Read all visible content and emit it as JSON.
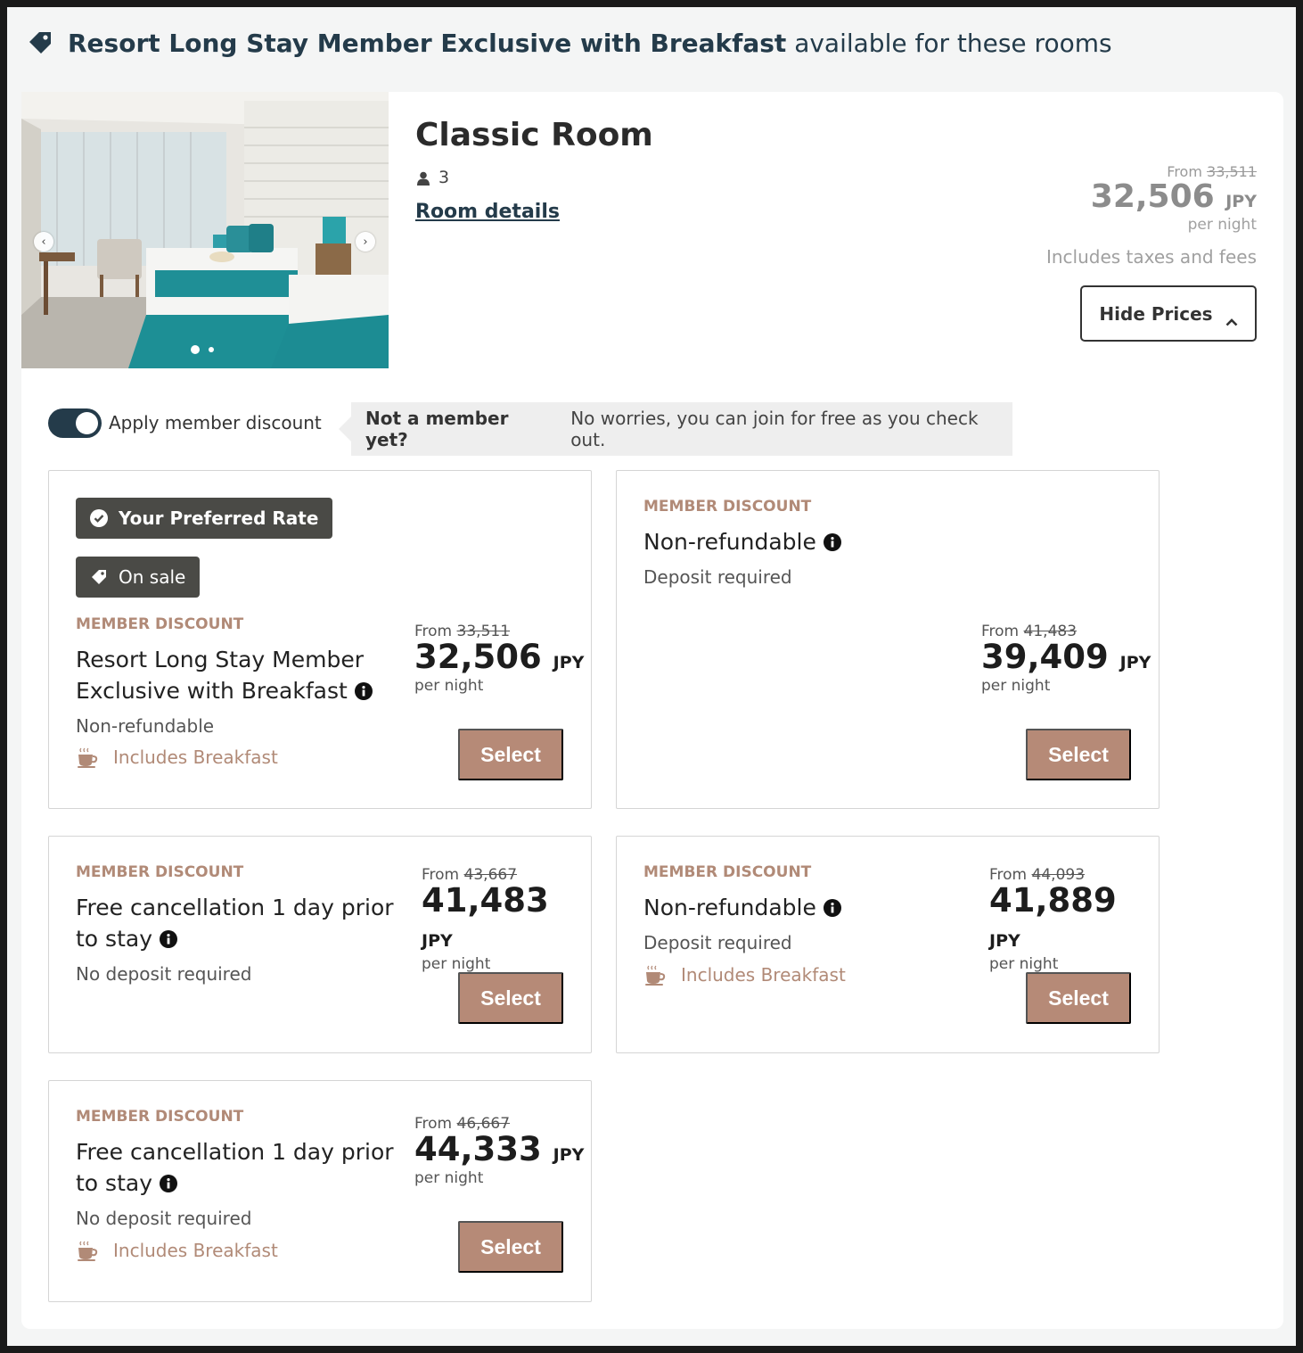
{
  "banner": {
    "icon": "tag-icon",
    "promo_name": "Resort Long Stay Member Exclusive with Breakfast",
    "suffix": "available for these rooms"
  },
  "room": {
    "title": "Classic Room",
    "occupancy": "3",
    "details_link": "Room details",
    "carousel": {
      "total_slides": 2,
      "active_slide": 1
    },
    "summary": {
      "from_label": "From",
      "was": "33,511",
      "price": "32,506",
      "currency": "JPY",
      "per_night": "per night",
      "taxes_note": "Includes taxes and fees"
    },
    "hide_prices_label": "Hide Prices"
  },
  "member": {
    "toggle_label": "Apply member discount",
    "toggle_on": true,
    "note_question": "Not a member yet?",
    "note_text": "No worries, you can join for free as you check out."
  },
  "colors": {
    "accent": "#b68a77",
    "navy": "#243b4a",
    "badge_bg": "#4a4a46"
  },
  "common": {
    "from_label": "From",
    "per_night": "per night",
    "currency": "JPY",
    "select_label": "Select",
    "member_discount_label": "MEMBER DISCOUNT",
    "breakfast_label": "Includes Breakfast"
  },
  "rates": [
    {
      "badges": [
        "Your Preferred Rate",
        "On sale"
      ],
      "name": "Resort Long Stay Member Exclusive with Breakfast",
      "policy": "Non-refundable",
      "breakfast": true,
      "was": "33,511",
      "price": "32,506"
    },
    {
      "name": "Non-refundable",
      "policy": "Deposit required",
      "breakfast": false,
      "was": "41,483",
      "price": "39,409"
    },
    {
      "name": "Free cancellation 1 day prior to stay",
      "policy": "No deposit required",
      "breakfast": false,
      "was": "43,667",
      "price": "41,483"
    },
    {
      "name": "Non-refundable",
      "policy": "Deposit required",
      "breakfast": true,
      "was": "44,093",
      "price": "41,889"
    },
    {
      "name": "Free cancellation 1 day prior to stay",
      "policy": "No deposit required",
      "breakfast": true,
      "was": "46,667",
      "price": "44,333"
    }
  ]
}
